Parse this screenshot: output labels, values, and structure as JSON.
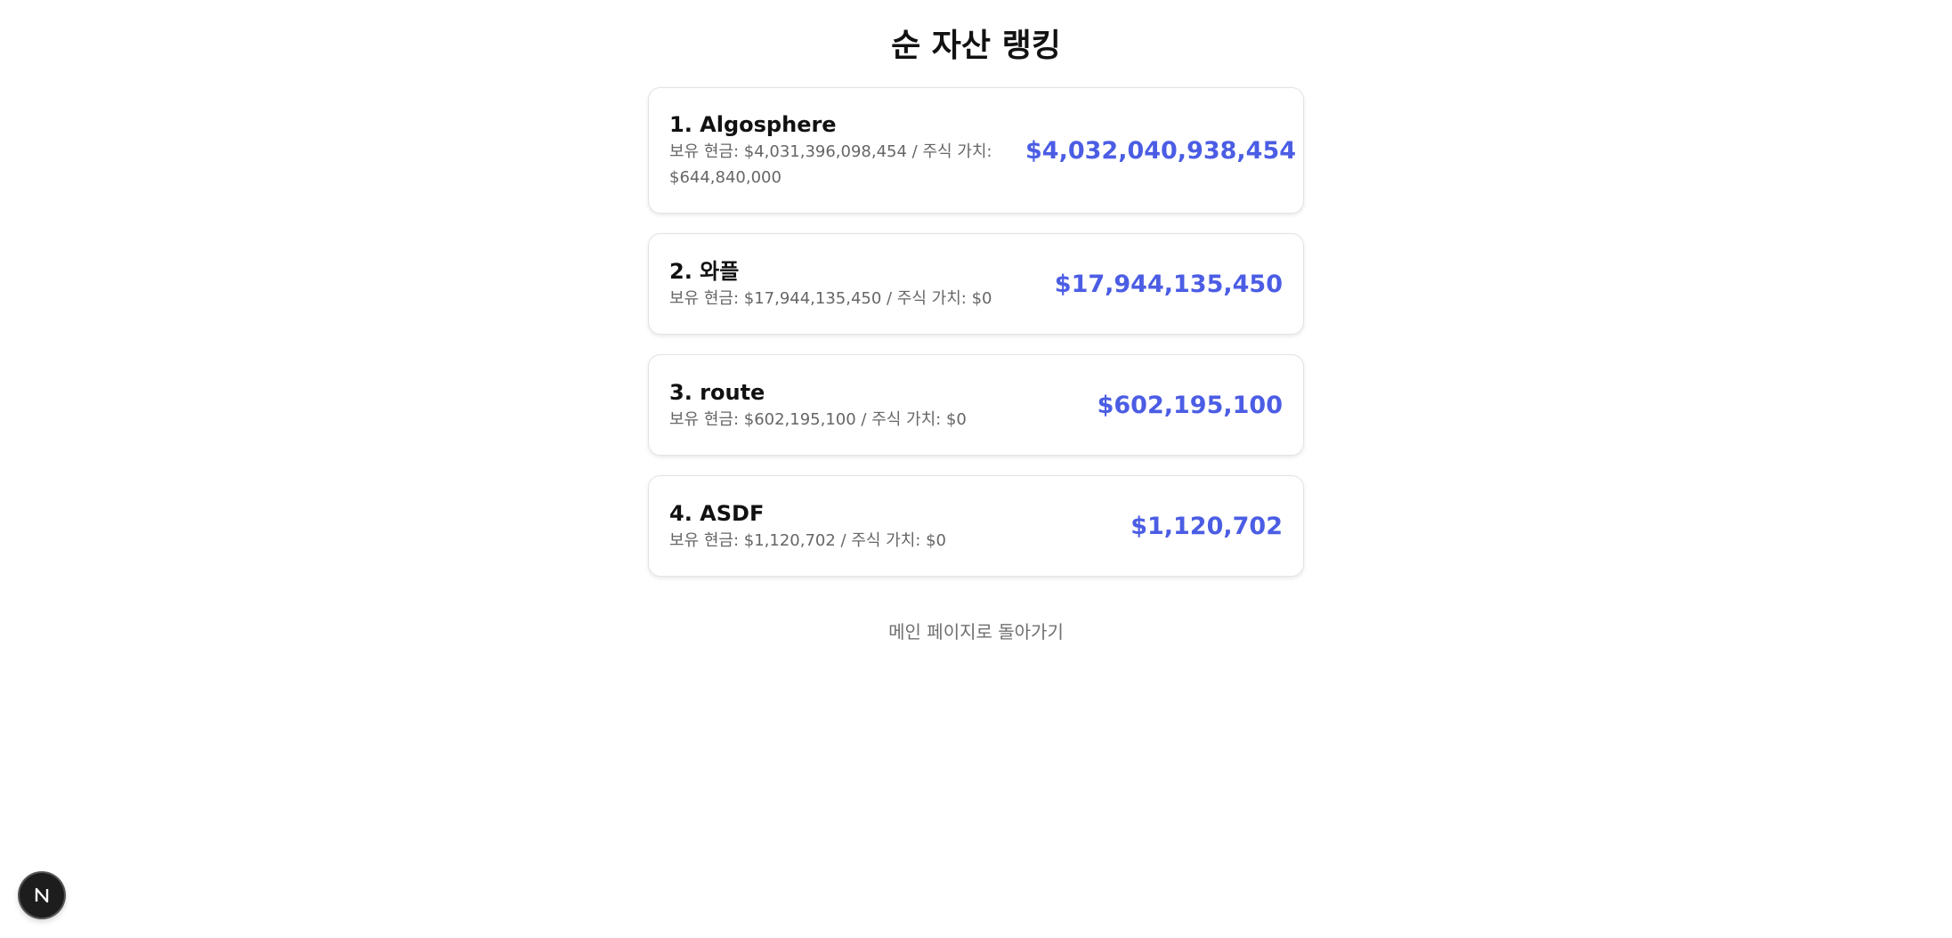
{
  "page": {
    "title": "순 자산 랭킹"
  },
  "ranking": [
    {
      "name": "1. Algosphere",
      "detail": "보유 현금: $4,031,396,098,454 / 주식 가치: $644,840,000",
      "total": "$4,032,040,938,454"
    },
    {
      "name": "2. 와플",
      "detail": "보유 현금: $17,944,135,450 / 주식 가치: $0",
      "total": "$17,944,135,450"
    },
    {
      "name": "3. route",
      "detail": "보유 현금: $602,195,100 / 주식 가치: $0",
      "total": "$602,195,100"
    },
    {
      "name": "4. ASDF",
      "detail": "보유 현금: $1,120,702 / 주식 가치: $0",
      "total": "$1,120,702"
    }
  ],
  "footer": {
    "back_link": "메인 페이지로 돌아가기"
  },
  "colors": {
    "accent": "#4b5de4",
    "muted_text": "#666666",
    "badge_bg": "#1d1d1d"
  },
  "icons": {
    "dev_badge": "n-logo-icon"
  }
}
